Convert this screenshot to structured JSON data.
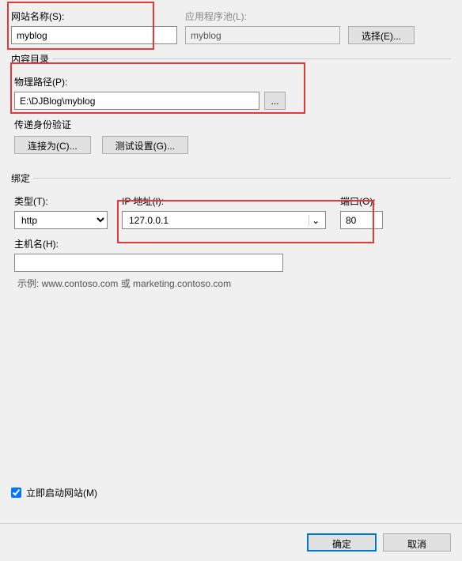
{
  "siteName": {
    "label": "网站名称(S):",
    "value": "myblog"
  },
  "appPool": {
    "label": "应用程序池(L):",
    "value": "myblog",
    "selectBtn": "选择(E)..."
  },
  "contentDir": {
    "legend": "内容目录",
    "physicalPath": {
      "label": "物理路径(P):",
      "value": "E:\\DJBlog\\myblog",
      "browseBtn": "..."
    },
    "passthroughAuth": "传递身份验证",
    "connectAsBtn": "连接为(C)...",
    "testSettingsBtn": "测试设置(G)..."
  },
  "binding": {
    "legend": "绑定",
    "type": {
      "label": "类型(T):",
      "value": "http"
    },
    "ip": {
      "label": "IP 地址(I):",
      "value": "127.0.0.1"
    },
    "port": {
      "label": "端口(O):",
      "value": "80"
    },
    "hostname": {
      "label": "主机名(H):",
      "value": ""
    },
    "example": "示例: www.contoso.com 或 marketing.contoso.com"
  },
  "startImmediately": {
    "label": "立即启动网站(M)",
    "checked": true
  },
  "buttons": {
    "ok": "确定",
    "cancel": "取消"
  }
}
